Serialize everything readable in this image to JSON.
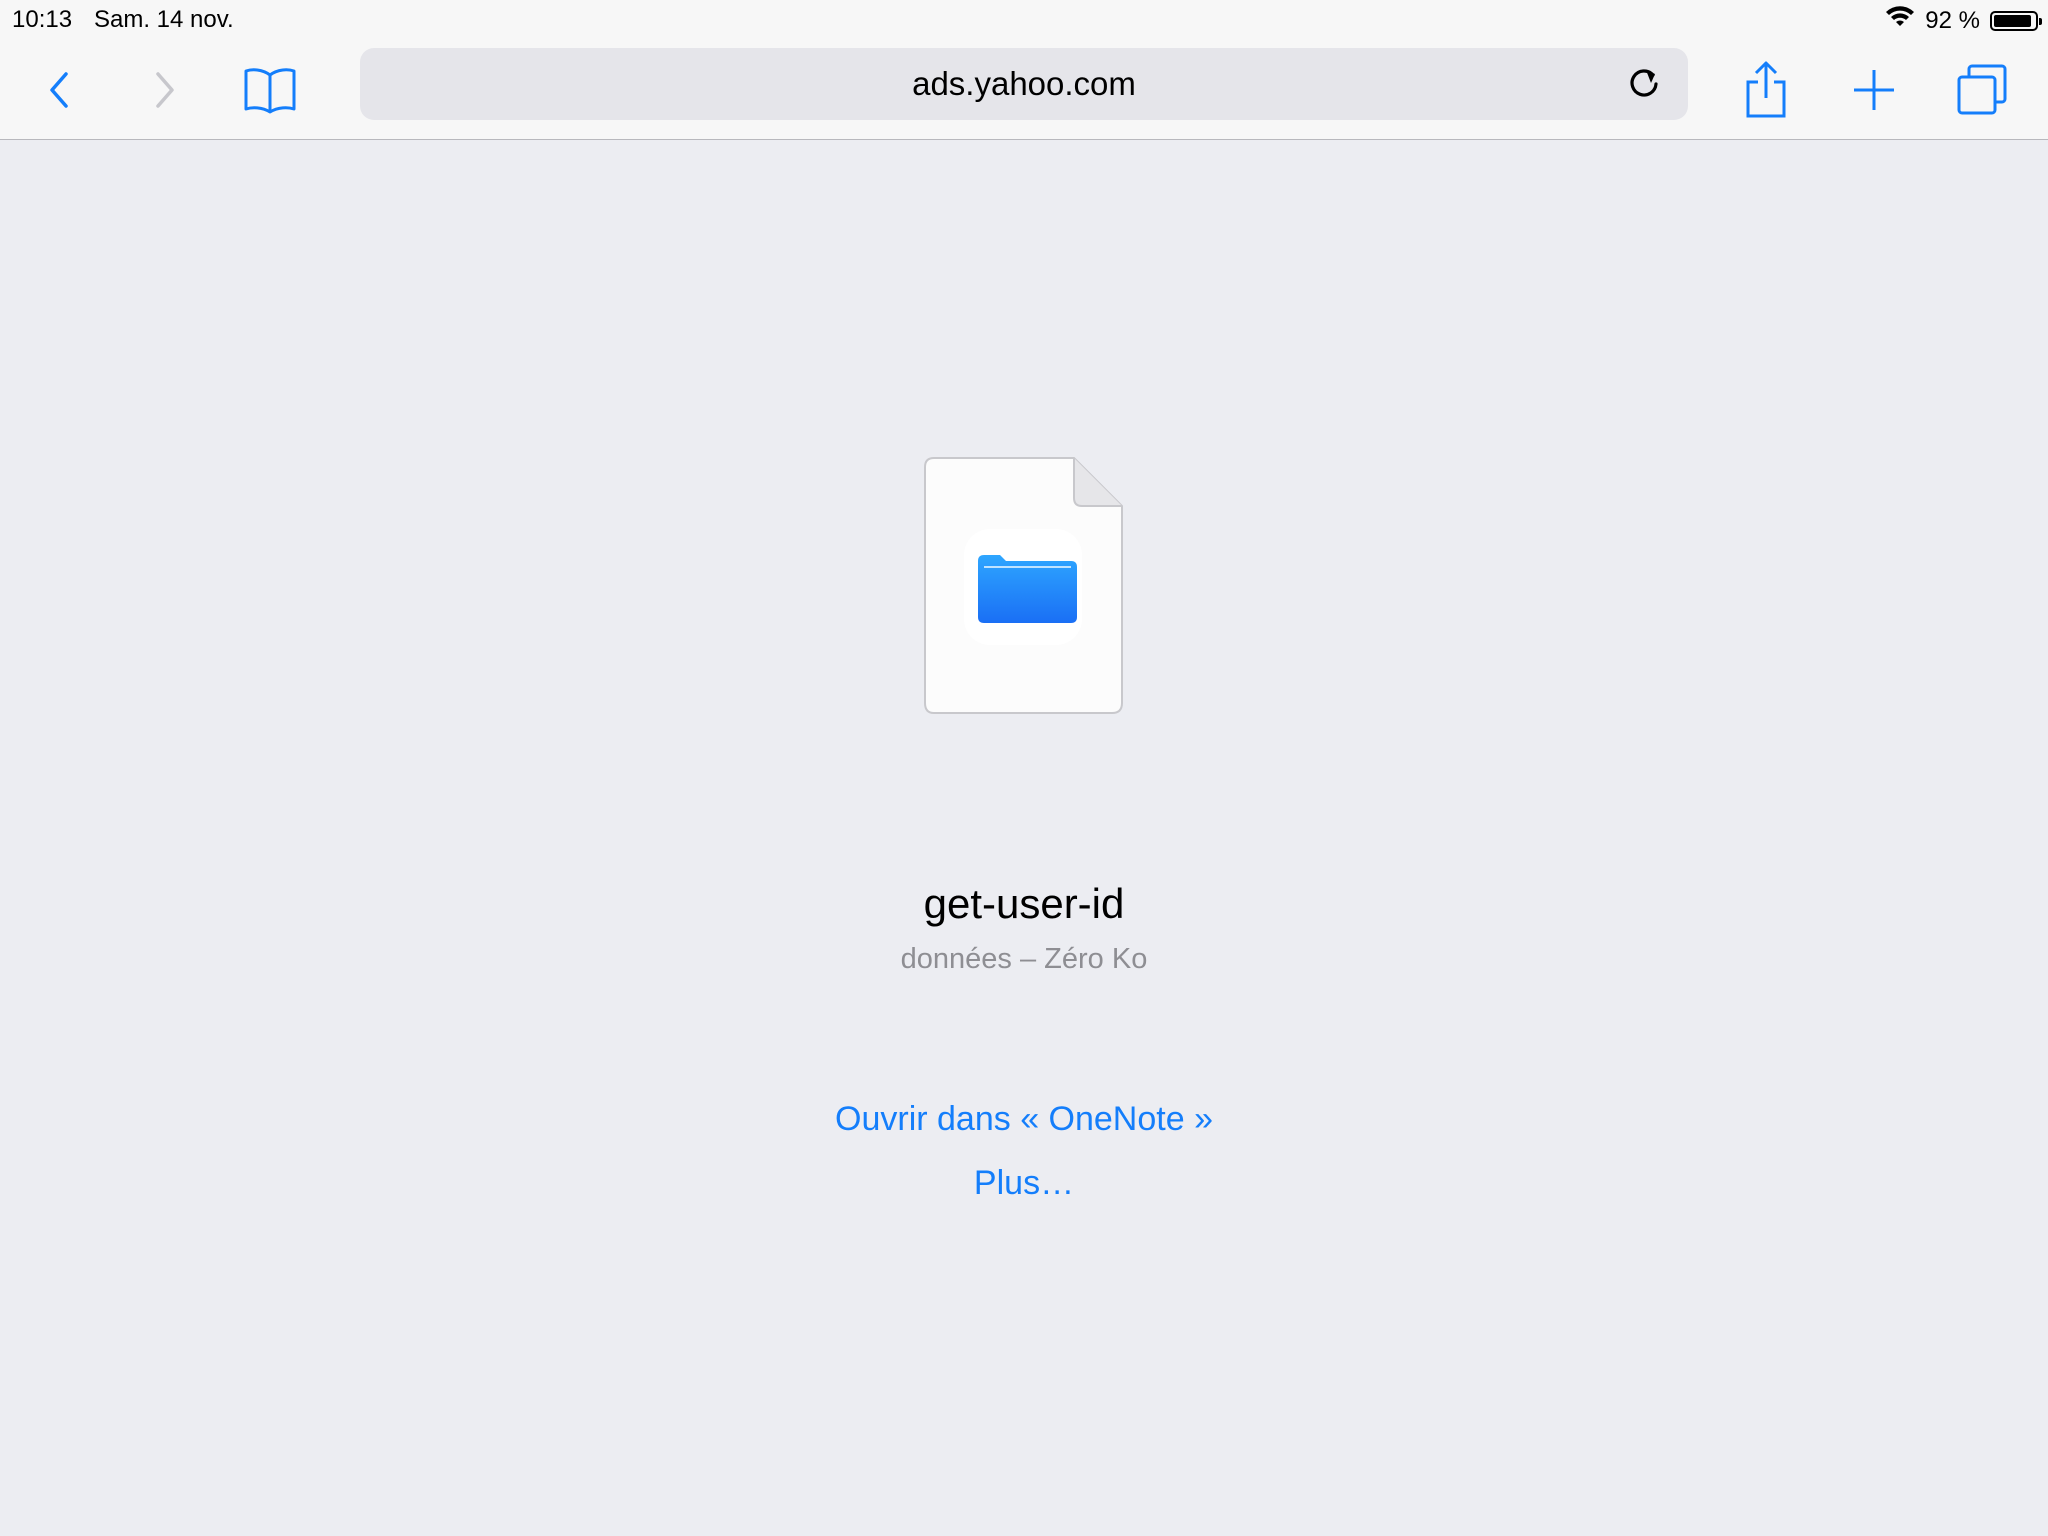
{
  "status_bar": {
    "time": "10:13",
    "date": "Sam. 14 nov.",
    "battery_text": "92 %",
    "battery_level": 0.92
  },
  "toolbar": {
    "address": "ads.yahoo.com",
    "icons": {
      "back": "chevron-left-icon",
      "forward": "chevron-right-icon",
      "bookmarks": "book-icon",
      "reload": "reload-icon",
      "share": "share-icon",
      "new_tab": "plus-icon",
      "tabs": "tabs-icon"
    }
  },
  "download": {
    "file_name": "get-user-id",
    "file_info": "données – Zéro Ko",
    "icon": "folder-icon"
  },
  "actions": {
    "open_in": "Ouvrir dans « OneNote »",
    "more": "Plus…"
  },
  "colors": {
    "accent": "#147efb",
    "background": "#ecedf2",
    "toolbar": "#f7f7f7",
    "secondary_text": "#8e8e93"
  }
}
